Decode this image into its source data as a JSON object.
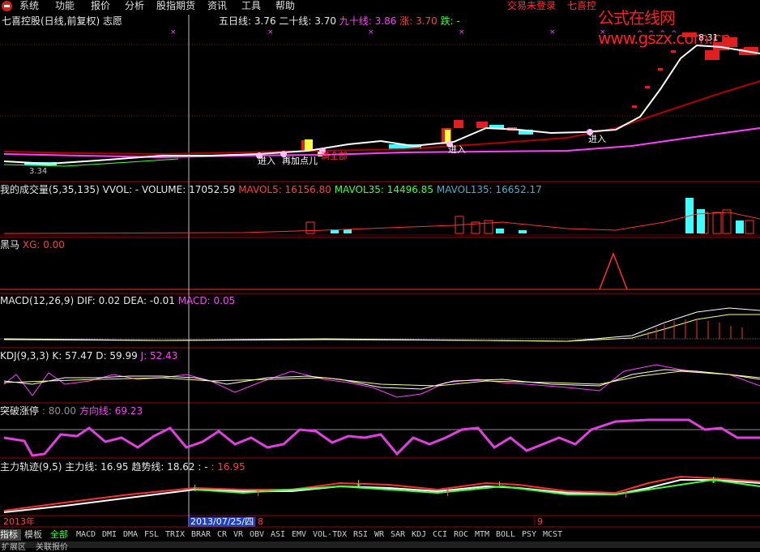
{
  "menu": {
    "items": [
      "系统",
      "功能",
      "报价",
      "分析",
      "股指期货",
      "资讯",
      "工具",
      "帮助"
    ],
    "status": "交易未登录",
    "brand": "七喜控",
    "watermark": "公式在线网www.gszx.com.cn"
  },
  "main_panel": {
    "title": "七喜控股(日线,前复权) 志愿",
    "ma5": "五日线: 3.76",
    "ma20": "二十线: 3.70",
    "ma90": "九十线: 3.86",
    "up": "涨: 3.70",
    "down": "跌: -",
    "price_high": "8.31",
    "price_low": "3.34",
    "signals": [
      "进入",
      "再加点儿",
      "满全部",
      "进入",
      "进入"
    ]
  },
  "volume_panel": {
    "title": "我的成交量(5,35,135) VVOL: -",
    "volume": "VOLUME: 17052.59",
    "mavol5": "MAVOL5: 16156.80",
    "mavol35": "MAVOL35: 14496.85",
    "mavol135": "MAVOL135: 16652.17"
  },
  "heima_panel": {
    "title": "黑马",
    "xg": "XG: 0.00"
  },
  "macd_panel": {
    "title": "MACD(12,26,9)",
    "dif": "DIF: 0.02",
    "dea": "DEA: -0.01",
    "macd": "MACD: 0.05"
  },
  "kdj_panel": {
    "title": "KDJ(9,3,3)",
    "k": "K: 57.47",
    "d": "D: 59.99",
    "j": "J: 52.43"
  },
  "breakout_panel": {
    "title": "突破涨停",
    "value": ": 80.00",
    "direction": "方向线: 69.23"
  },
  "track_panel": {
    "title": "主力轨迹(9,5)",
    "main": "主力线: 16.95",
    "trend": "趋势线: 18.62",
    "sep": ": -",
    "extra": ": 16.95"
  },
  "time_axis": {
    "year": "2013年",
    "cursor_date": "2013/07/25/四",
    "month8": "8",
    "month9": "9"
  },
  "tabs": [
    "指标",
    "模板",
    "全部",
    "MACD",
    "DMI",
    "DMA",
    "FSL",
    "TRIX",
    "BRAR",
    "CR",
    "VR",
    "OBV",
    "ASI",
    "EMV",
    "VOL-TDX",
    "RSI",
    "WR",
    "SAR",
    "KDJ",
    "CCI",
    "ROC",
    "MTM",
    "BOLL",
    "PSY",
    "MCST"
  ],
  "bottom": [
    "扩展区",
    "关联报价"
  ],
  "colors": {
    "background": "#000000",
    "panel_border": "#a00000",
    "rising": "#ff3030",
    "falling": "#40ffff",
    "magenta": "#ff40ff"
  }
}
